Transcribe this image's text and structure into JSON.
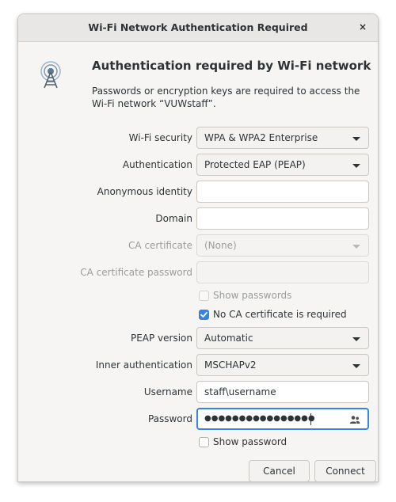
{
  "window": {
    "title": "Wi-Fi Network Authentication Required"
  },
  "header": {
    "heading": "Authentication required by Wi-Fi network",
    "message": "Passwords or encryption keys are required to access the Wi-Fi network “VUWstaff”."
  },
  "form": {
    "wifi_security": {
      "label": "Wi-Fi security",
      "value": "WPA & WPA2 Enterprise"
    },
    "authentication": {
      "label": "Authentication",
      "value": "Protected EAP (PEAP)"
    },
    "anonymous_identity": {
      "label": "Anonymous identity",
      "value": ""
    },
    "domain": {
      "label": "Domain",
      "value": ""
    },
    "ca_certificate": {
      "label": "CA certificate",
      "value": "(None)"
    },
    "ca_certificate_password": {
      "label": "CA certificate password",
      "value": ""
    },
    "show_passwords": {
      "label": "Show passwords",
      "checked": false
    },
    "no_ca_required": {
      "label": "No CA certificate is required",
      "checked": true
    },
    "peap_version": {
      "label": "PEAP version",
      "value": "Automatic"
    },
    "inner_auth": {
      "label": "Inner authentication",
      "value": "MSCHAPv2"
    },
    "username": {
      "label": "Username",
      "value": "staff\\username"
    },
    "password": {
      "label": "Password",
      "masked": "●●●●●●●●●●●●●●●●"
    },
    "show_password": {
      "label": "Show password",
      "checked": false
    }
  },
  "buttons": {
    "cancel": "Cancel",
    "connect": "Connect"
  },
  "icons": {
    "close": "×",
    "app": "wifi-network-icon",
    "password_storage": "people-icon"
  },
  "colors": {
    "accent": "#3584e4"
  }
}
